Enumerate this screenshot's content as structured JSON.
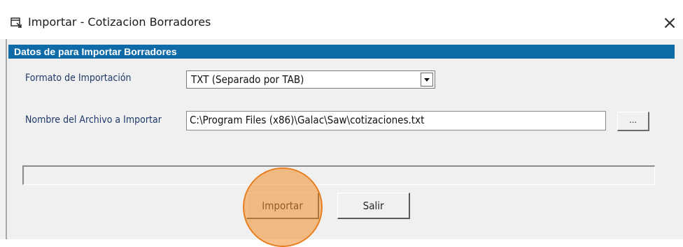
{
  "window": {
    "title": "Importar - Cotizacion Borradores",
    "icon": "window-app-icon",
    "close_glyph": "×"
  },
  "section": {
    "header": "Datos de para  Importar Borradores"
  },
  "form": {
    "format_label": "Formato de Importación",
    "format_value": "TXT (Separado por TAB)",
    "file_label": "Nombre del Archivo a Importar",
    "file_value": "C:\\Program Files (x86)\\Galac\\Saw\\cotizaciones.txt",
    "browse_label": "..."
  },
  "progress": {
    "value": 0
  },
  "buttons": {
    "import_label": "Importar",
    "exit_label": "Salir"
  },
  "colors": {
    "header_bg": "#0f6ba8",
    "highlight": "#f28c28"
  }
}
